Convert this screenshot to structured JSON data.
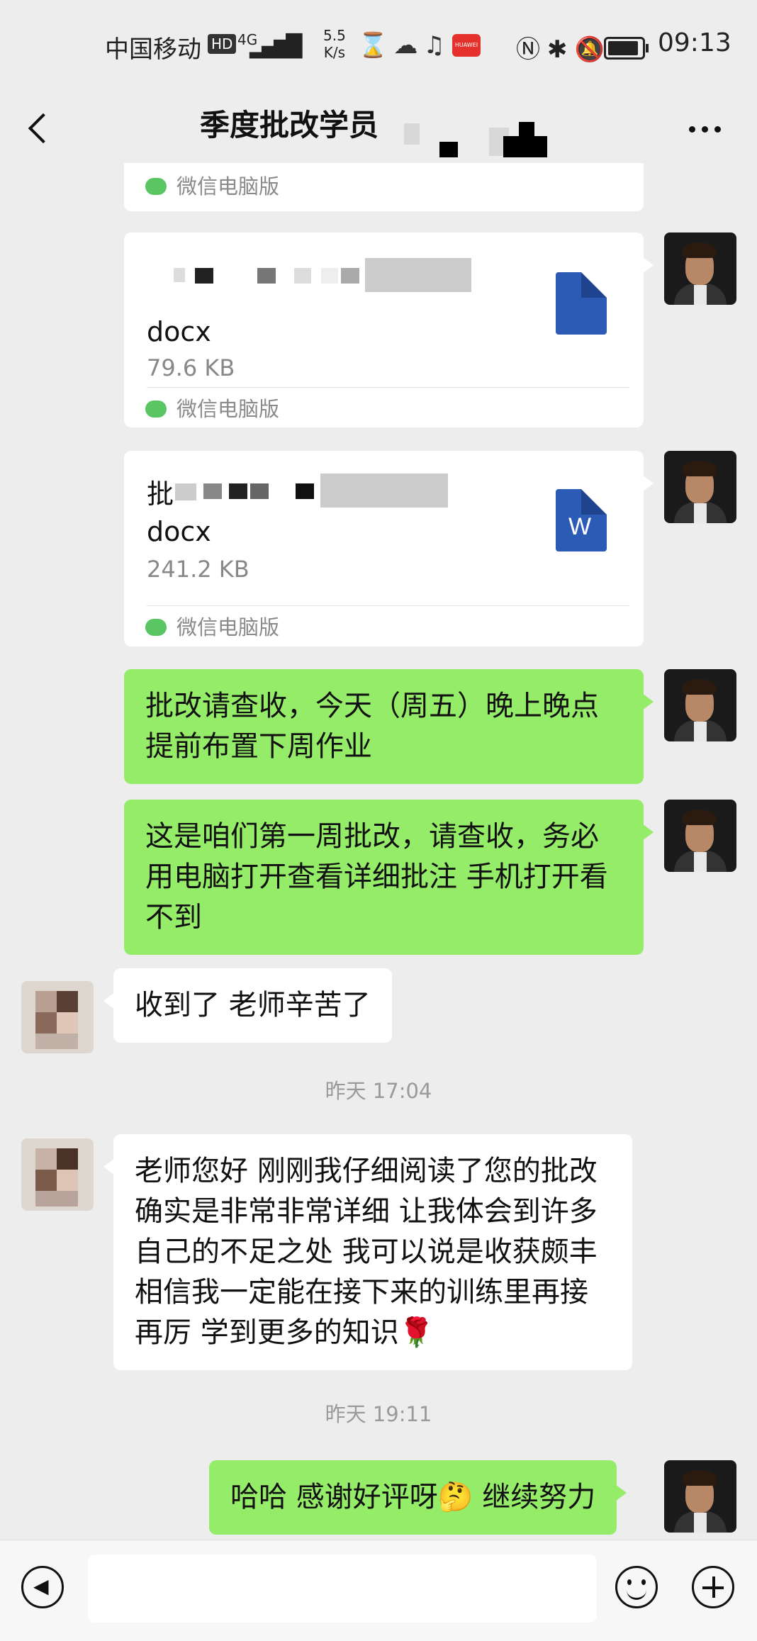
{
  "status_bar": {
    "carrier": "中国移动",
    "hd": "HD",
    "network": "4G",
    "speed_value": "5.5",
    "speed_unit": "K/s",
    "huawei": "HUAWEI",
    "time": "09:13",
    "battery_level": 0.8
  },
  "header": {
    "title": "季度批改学员"
  },
  "messages": {
    "card0": {
      "source": "微信电脑版"
    },
    "card1": {
      "filename": "docx",
      "size": "79.6 KB",
      "source": "微信电脑版"
    },
    "card2": {
      "filename_prefix": "批",
      "filename": "docx",
      "size": "241.2 KB",
      "source": "微信电脑版",
      "icon_letter": "W"
    },
    "msg1": "批改请查收，今天（周五）晚上晚点提前布置下周作业",
    "msg2": "这是咱们第一周批改，请查收，务必用电脑打开查看详细批注 手机打开看不到",
    "msg3": "收到了 老师辛苦了",
    "ts1": "昨天 17:04",
    "msg4": "老师您好 刚刚我仔细阅读了您的批改 确实是非常非常详细 让我体会到许多自己的不足之处 我可以说是收获颇丰 相信我一定能在接下来的训练里再接再厉 学到更多的知识🌹",
    "ts2": "昨天 19:11",
    "msg5": "哈哈 感谢好评呀🤔 继续努力"
  },
  "icons": [
    "back-icon",
    "more-icon",
    "file-word-icon",
    "wechat-icon",
    "voice-icon",
    "emoji-icon",
    "plus-icon"
  ],
  "colors": {
    "background": "#ededed",
    "sent_bubble": "#95ec69",
    "received_bubble": "#ffffff",
    "word_blue": "#2c5bb5"
  }
}
